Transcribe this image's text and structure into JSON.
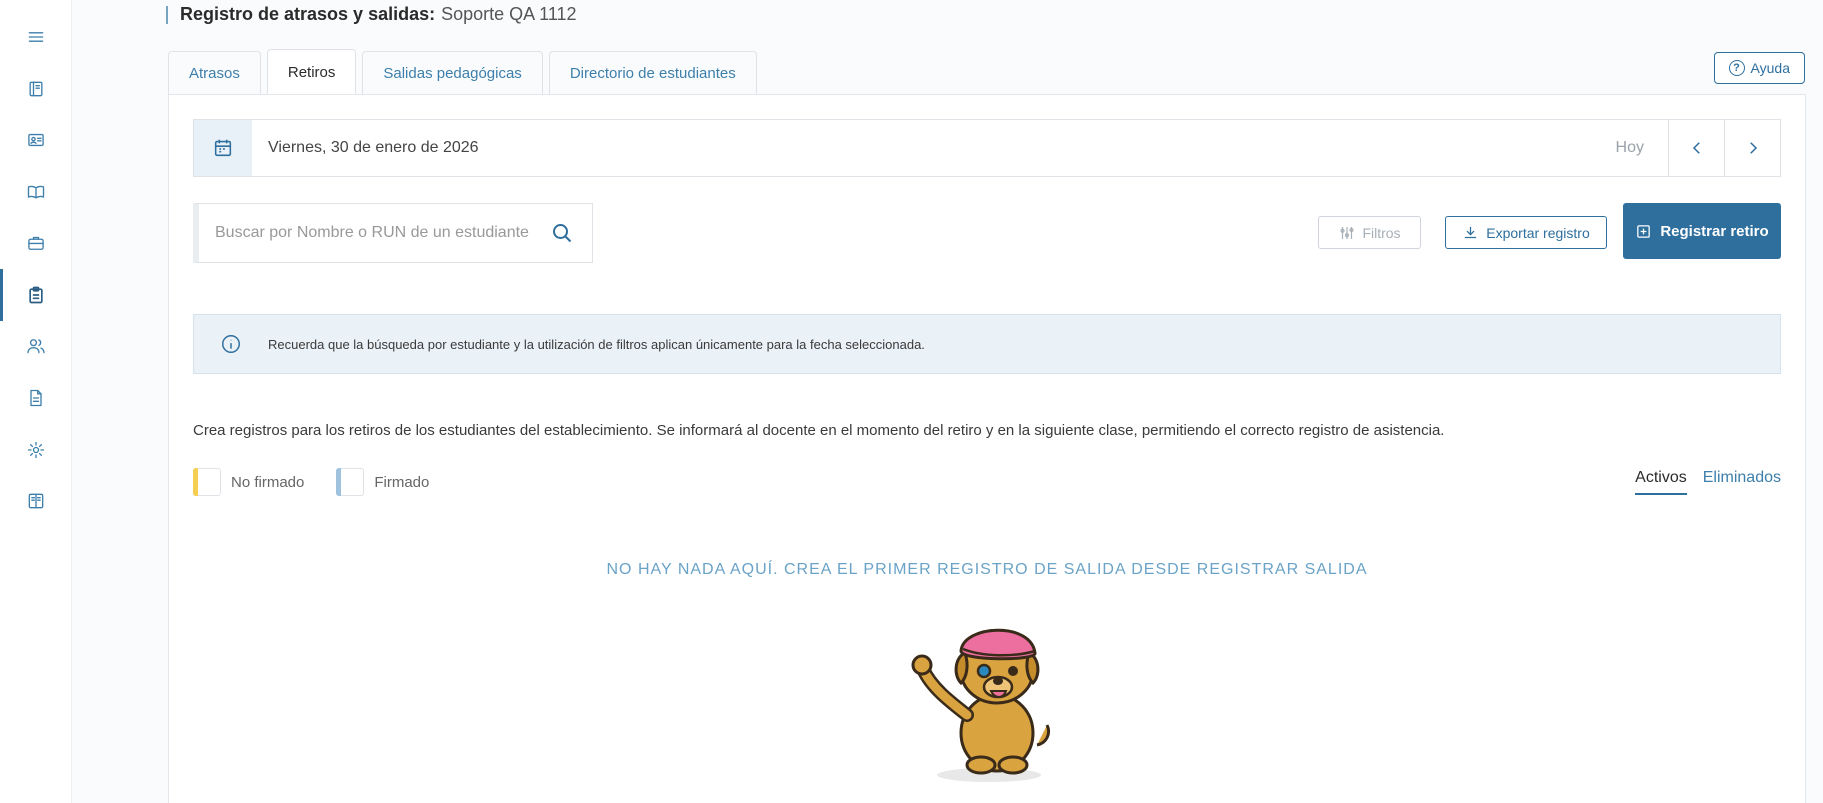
{
  "page": {
    "title_strong": "Registro de atrasos y salidas:",
    "title_sub": "Soporte QA 1112"
  },
  "sidebar": {
    "items": [
      {
        "icon": "menu-icon"
      },
      {
        "icon": "notebook-icon"
      },
      {
        "icon": "id-card-icon"
      },
      {
        "icon": "book-icon"
      },
      {
        "icon": "briefcase-icon"
      },
      {
        "icon": "clipboard-icon",
        "active": true
      },
      {
        "icon": "users-icon"
      },
      {
        "icon": "document-icon"
      },
      {
        "icon": "gear-icon"
      },
      {
        "icon": "manual-icon"
      }
    ]
  },
  "tabs": [
    {
      "label": "Atrasos"
    },
    {
      "label": "Retiros",
      "active": true
    },
    {
      "label": "Salidas pedagógicas"
    },
    {
      "label": "Directorio de estudiantes"
    }
  ],
  "help": {
    "label": "Ayuda"
  },
  "date_bar": {
    "date": "Viernes, 30 de enero de 2026",
    "today": "Hoy"
  },
  "search": {
    "placeholder": "Buscar por Nombre o RUN de un estudiante"
  },
  "actions": {
    "filters": "Filtros",
    "export": "Exportar registro",
    "register": "Registrar retiro"
  },
  "info": {
    "text": "Recuerda que la búsqueda por estudiante y la utilización de filtros aplican únicamente para la fecha seleccionada."
  },
  "description": "Crea registros para los retiros de los estudiantes del establecimiento. Se informará al docente en el momento del retiro y en la siguiente clase, permitiendo el correcto registro de asistencia.",
  "legend": {
    "unsigned": "No firmado",
    "signed": "Firmado",
    "unsigned_color": "#f6cf52",
    "signed_color": "#9fc3de"
  },
  "state_tabs": {
    "active": "Activos",
    "deleted": "Eliminados"
  },
  "empty_state": {
    "message": "NO HAY NADA AQUÍ. CREA EL PRIMER REGISTRO DE SALIDA DESDE REGISTRAR SALIDA"
  },
  "colors": {
    "primary": "#2e6f9e",
    "link": "#3d7fab",
    "info_bg": "#eaf1f7"
  }
}
